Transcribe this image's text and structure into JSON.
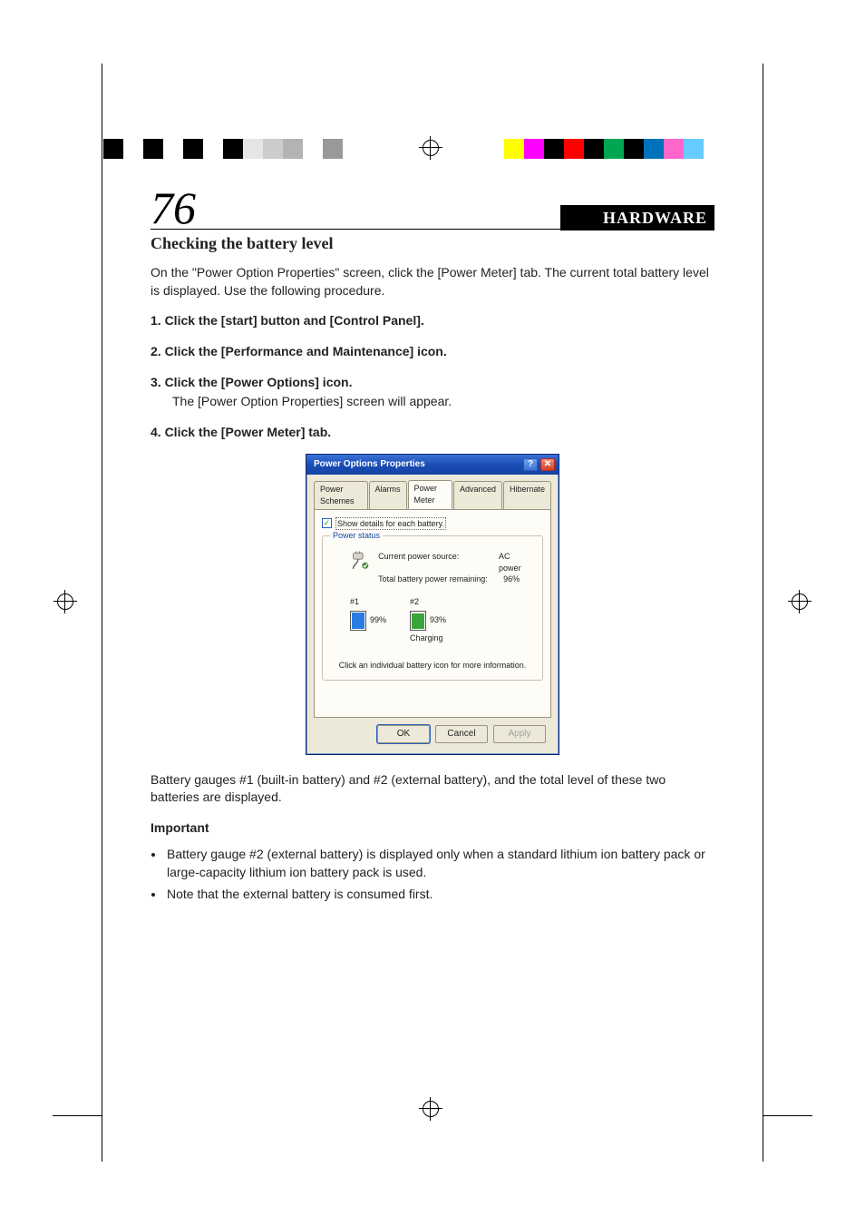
{
  "page_number": "76",
  "section_tab": "HARDWARE",
  "heading": "Checking the battery level",
  "intro": "On the \"Power Option Properties\" screen, click the [Power Meter] tab.  The current total battery level is displayed.  Use the following procedure.",
  "steps": [
    {
      "num": "1.",
      "text": "Click the [start] button and [Control Panel]."
    },
    {
      "num": "2.",
      "text": "Click the [Performance and Maintenance] icon."
    },
    {
      "num": "3.",
      "text": "Click the [Power Options] icon.",
      "sub": "The [Power Option Properties] screen will appear."
    },
    {
      "num": "4.",
      "text": "Click the [Power Meter] tab."
    }
  ],
  "dialog": {
    "title": "Power Options Properties",
    "help_glyph": "?",
    "close_glyph": "✕",
    "tabs": [
      "Power Schemes",
      "Alarms",
      "Power Meter",
      "Advanced",
      "Hibernate"
    ],
    "active_tab_index": 2,
    "show_details_label": "Show details for each battery.",
    "show_details_checked": true,
    "fieldset_legend": "Power status",
    "current_source_label": "Current power source:",
    "current_source_value": "AC power",
    "total_remaining_label": "Total battery power remaining:",
    "total_remaining_value": "96%",
    "batteries": [
      {
        "head": "#1",
        "percent_text": "99%",
        "percent": 99,
        "charging": false,
        "sub": ""
      },
      {
        "head": "#2",
        "percent_text": "93%",
        "percent": 93,
        "charging": true,
        "sub": "Charging"
      }
    ],
    "hint": "Click an individual battery icon for more information.",
    "buttons": {
      "ok": "OK",
      "cancel": "Cancel",
      "apply": "Apply"
    }
  },
  "post_dialog": "Battery gauges #1 (built-in battery) and #2 (external battery), and the total level of these two batteries are displayed.",
  "important_label": "Important",
  "important_notes": [
    "Battery gauge #2 (external battery) is displayed only when a standard lithium ion battery pack or large-capacity lithium ion battery pack is used.",
    "Note that the external battery is consumed first."
  ],
  "colorbars": {
    "left": [
      "#000000",
      "#ffffff",
      "#000000",
      "#ffffff",
      "#000000",
      "#ffffff",
      "#000000",
      "#e6e6e6",
      "#cccccc",
      "#b3b3b3",
      "#ffffff",
      "#999999"
    ],
    "right": [
      "#ffff00",
      "#ff00ff",
      "#000000",
      "#ff0000",
      "#000000",
      "#00a651",
      "#000000",
      "#0072bc",
      "#ff66cc",
      "#66ccff",
      "#ffffff"
    ]
  }
}
